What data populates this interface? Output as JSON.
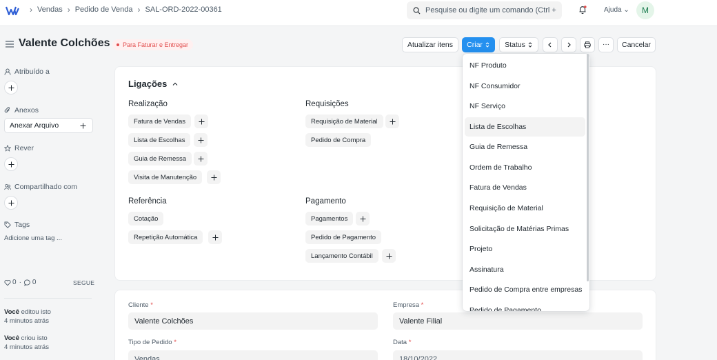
{
  "navbar": {
    "breadcrumbs": [
      "Vendas",
      "Pedido de Venda",
      "SAL-ORD-2022-00361"
    ],
    "search_placeholder": "Pesquise ou digite um comando (Ctrl + G",
    "help_label": "Ajuda",
    "avatar_initial": "M"
  },
  "page": {
    "title": "Valente Colchões",
    "status": "Para Faturar e Entregar",
    "status_color": "#e24c4c"
  },
  "toolbar": {
    "update_items": "Atualizar itens",
    "create": "Criar",
    "status": "Status",
    "cancel": "Cancelar"
  },
  "sidebar": {
    "assigned": "Atribuído a",
    "attachments": "Anexos",
    "attach_file": "Anexar Arquivo",
    "review": "Rever",
    "shared": "Compartilhado com",
    "tags": "Tags",
    "add_tag": "Adicione uma tag ...",
    "likes": "0",
    "comments": "0",
    "follow": "SEGUE",
    "activity": [
      {
        "who": "Você",
        "what": " editou isto",
        "when": "4 minutos atrás"
      },
      {
        "who": "Você",
        "what": " criou isto",
        "when": "4 minutos atrás"
      }
    ]
  },
  "connections": {
    "title": "Ligações",
    "groups": [
      {
        "title": "Realização",
        "items": [
          "Fatura de Vendas",
          "Lista de Escolhas",
          "Guia de Remessa",
          "Visita de Manutenção"
        ]
      },
      {
        "title": "Requisições",
        "items": [
          "Requisição de Material",
          "Pedido de Compra"
        ]
      },
      {
        "title": "Referência",
        "items": [
          "Cotação",
          "Repetição Automática"
        ]
      },
      {
        "title": "Pagamento",
        "items": [
          "Pagamentos",
          "Pedido de Pagamento",
          "Lançamento Contábil"
        ]
      }
    ]
  },
  "form": {
    "customer_label": "Cliente",
    "customer_value": "Valente Colchões",
    "company_label": "Empresa",
    "company_value": "Valente Filial",
    "order_type_label": "Tipo de Pedido",
    "order_type_value": "Vendas",
    "date_label": "Data",
    "date_value": "18/10/2022"
  },
  "create_menu": [
    "NF Produto",
    "NF Consumidor",
    "NF Serviço",
    "Lista de Escolhas",
    "Guia de Remessa",
    "Ordem de Trabalho",
    "Fatura de Vendas",
    "Requisição de Material",
    "Solicitação de Matérias Primas",
    "Projeto",
    "Assinatura",
    "Pedido de Compra entre empresas",
    "Pedido de Pagamento"
  ],
  "colors": {
    "primary": "#2490ef",
    "background": "#f4f5f6"
  }
}
